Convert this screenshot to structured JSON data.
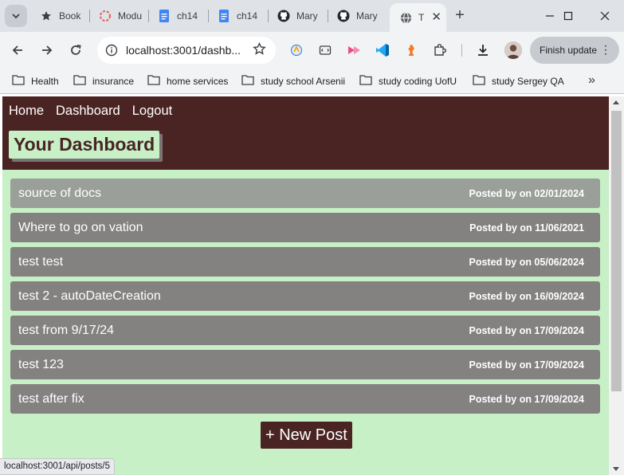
{
  "browser": {
    "tabs": [
      {
        "title": "Book",
        "icon": "star-icon"
      },
      {
        "title": "Modu",
        "icon": "loading-ring-icon"
      },
      {
        "title": "ch14",
        "icon": "google-docs-icon"
      },
      {
        "title": "ch14",
        "icon": "google-docs-icon"
      },
      {
        "title": "Mary",
        "icon": "github-icon"
      },
      {
        "title": "Mary",
        "icon": "github-icon"
      },
      {
        "title": "T",
        "icon": "globe-icon"
      }
    ],
    "url": "localhost:3001/dashb...",
    "finish_update_label": "Finish update",
    "bookmarks": [
      "Health",
      "insurance",
      "home services",
      "study school Arsenii",
      "study coding UofU",
      "study Sergey QA"
    ],
    "status_url": "localhost:3001/api/posts/5"
  },
  "page": {
    "nav": {
      "home": "Home",
      "dashboard": "Dashboard",
      "logout": "Logout"
    },
    "title": "Your Dashboard",
    "posts": [
      {
        "title": "source of docs",
        "meta": "Posted by on 02/01/2024"
      },
      {
        "title": "Where to go on vation",
        "meta": "Posted by on 11/06/2021"
      },
      {
        "title": "test test",
        "meta": "Posted by on 05/06/2024"
      },
      {
        "title": "test 2 - autoDateCreation",
        "meta": "Posted by on 16/09/2024"
      },
      {
        "title": "test from 9/17/24",
        "meta": "Posted by on 17/09/2024"
      },
      {
        "title": "test 123",
        "meta": "Posted by on 17/09/2024"
      },
      {
        "title": "test after fix",
        "meta": "Posted by on 17/09/2024"
      }
    ],
    "new_post_label": "+ New Post"
  },
  "colors": {
    "header_bg": "#4a2423",
    "page_bg": "#c7f0c7",
    "post_bg": "#848181"
  }
}
